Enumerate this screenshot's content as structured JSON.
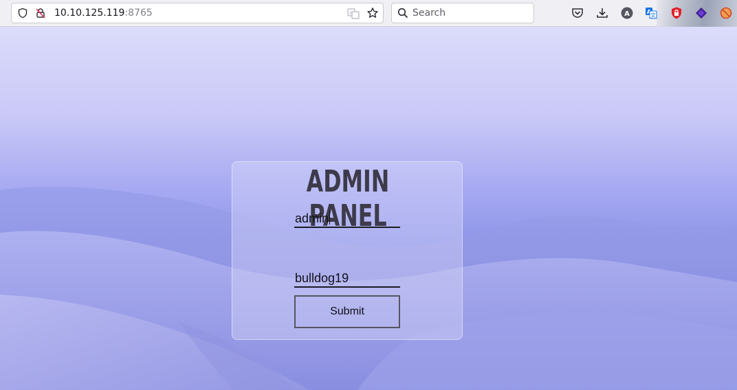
{
  "browser": {
    "url_host": "10.10.125.119",
    "url_port": ":8765",
    "search_placeholder": "Search",
    "icons": [
      "shield-icon",
      "insecure-lock-icon",
      "translate-icon",
      "bookmark-star-icon",
      "search-icon",
      "pocket-icon",
      "download-icon",
      "account-avatar-icon",
      "translate-extension-icon",
      "ublock-shield-icon",
      "proton-extension-icon",
      "no-script-icon"
    ],
    "avatar_letter": "A"
  },
  "login": {
    "title": "Admin Panel",
    "username_value": "admin",
    "password_value": "bulldog19",
    "submit_label": "Submit"
  },
  "colors": {
    "panel_title": "#3d3b4a",
    "sky_top": "#dcdcfb",
    "dune": "#8a8fe0"
  }
}
